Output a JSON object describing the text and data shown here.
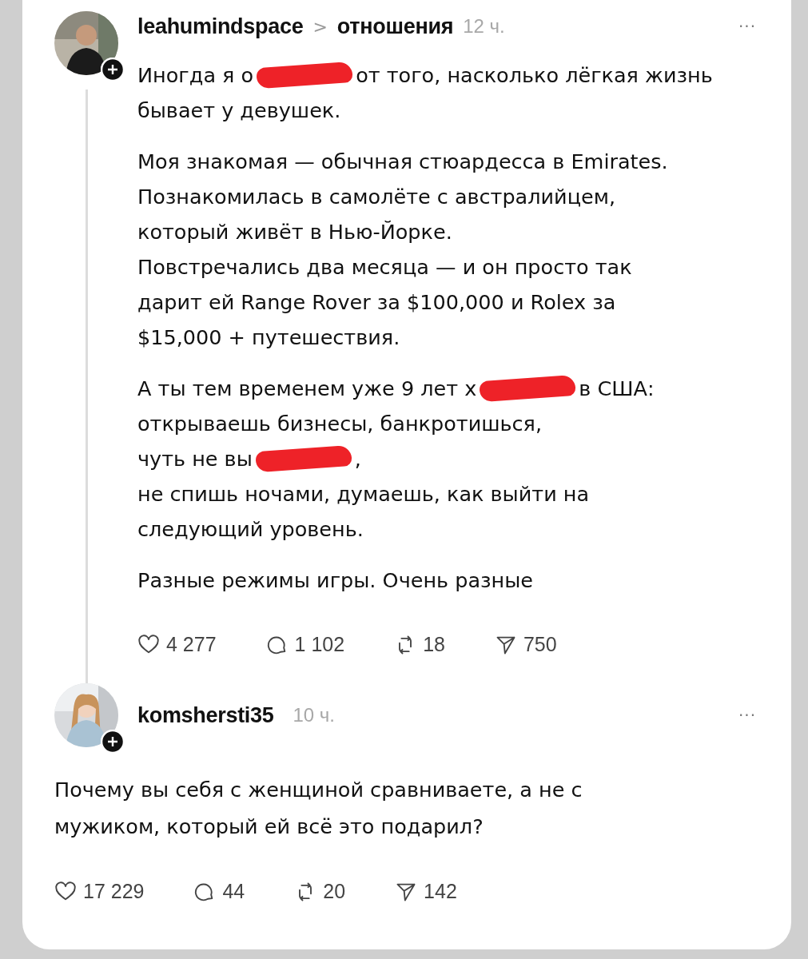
{
  "post": {
    "username": "leahumindspace",
    "separator": ">",
    "topic": "отношения",
    "time": "12 ч.",
    "more": "···",
    "paragraphs": [
      [
        [
          {
            "kind": "text",
            "text": "Иногда я о"
          },
          {
            "kind": "redaction"
          },
          {
            "kind": "text",
            "text": "от того, насколько лёгкая жизнь"
          }
        ],
        [
          {
            "kind": "text",
            "text": "бывает у девушек."
          }
        ]
      ],
      [
        [
          {
            "kind": "text",
            "text": "Моя знакомая — обычная стюардесса в Emirates."
          }
        ],
        [
          {
            "kind": "text",
            "text": "Познакомилась в самолёте с австралийцем,"
          }
        ],
        [
          {
            "kind": "text",
            "text": "который живёт в Нью-Йорке."
          }
        ],
        [
          {
            "kind": "text",
            "text": "Повстречались два месяца — и он просто так"
          }
        ],
        [
          {
            "kind": "text",
            "text": "дарит ей Range Rover за $100,000 и Rolex за"
          }
        ],
        [
          {
            "kind": "text",
            "text": "$15,000 + путешествия."
          }
        ]
      ],
      [
        [
          {
            "kind": "text",
            "text": "А ты тем временем уже 9 лет х"
          },
          {
            "kind": "redaction"
          },
          {
            "kind": "text",
            "text": "в США:"
          }
        ],
        [
          {
            "kind": "text",
            "text": "открываешь бизнесы, банкротишься,"
          }
        ],
        [
          {
            "kind": "text",
            "text": "чуть не вы"
          },
          {
            "kind": "redaction"
          },
          {
            "kind": "text",
            "text": ","
          }
        ],
        [
          {
            "kind": "text",
            "text": "не спишь ночами, думаешь, как выйти на"
          }
        ],
        [
          {
            "kind": "text",
            "text": "следующий уровень."
          }
        ]
      ],
      [
        [
          {
            "kind": "text",
            "text": "Разные режимы игры. Очень разные"
          }
        ]
      ]
    ],
    "actions": [
      {
        "kind": "like",
        "count": "4 277"
      },
      {
        "kind": "comment",
        "count": "1 102"
      },
      {
        "kind": "repost",
        "count": "18"
      },
      {
        "kind": "share",
        "count": "750"
      }
    ]
  },
  "reply": {
    "username": "komshersti35",
    "time": "10 ч.",
    "more": "···",
    "lines": [
      "Почему вы себя с женщиной сравниваете, а не с",
      "мужиком, который ей всё это подарил?"
    ],
    "actions": [
      {
        "kind": "like",
        "count": "17 229"
      },
      {
        "kind": "comment",
        "count": "44"
      },
      {
        "kind": "repost",
        "count": "20"
      },
      {
        "kind": "share",
        "count": "142"
      }
    ]
  }
}
